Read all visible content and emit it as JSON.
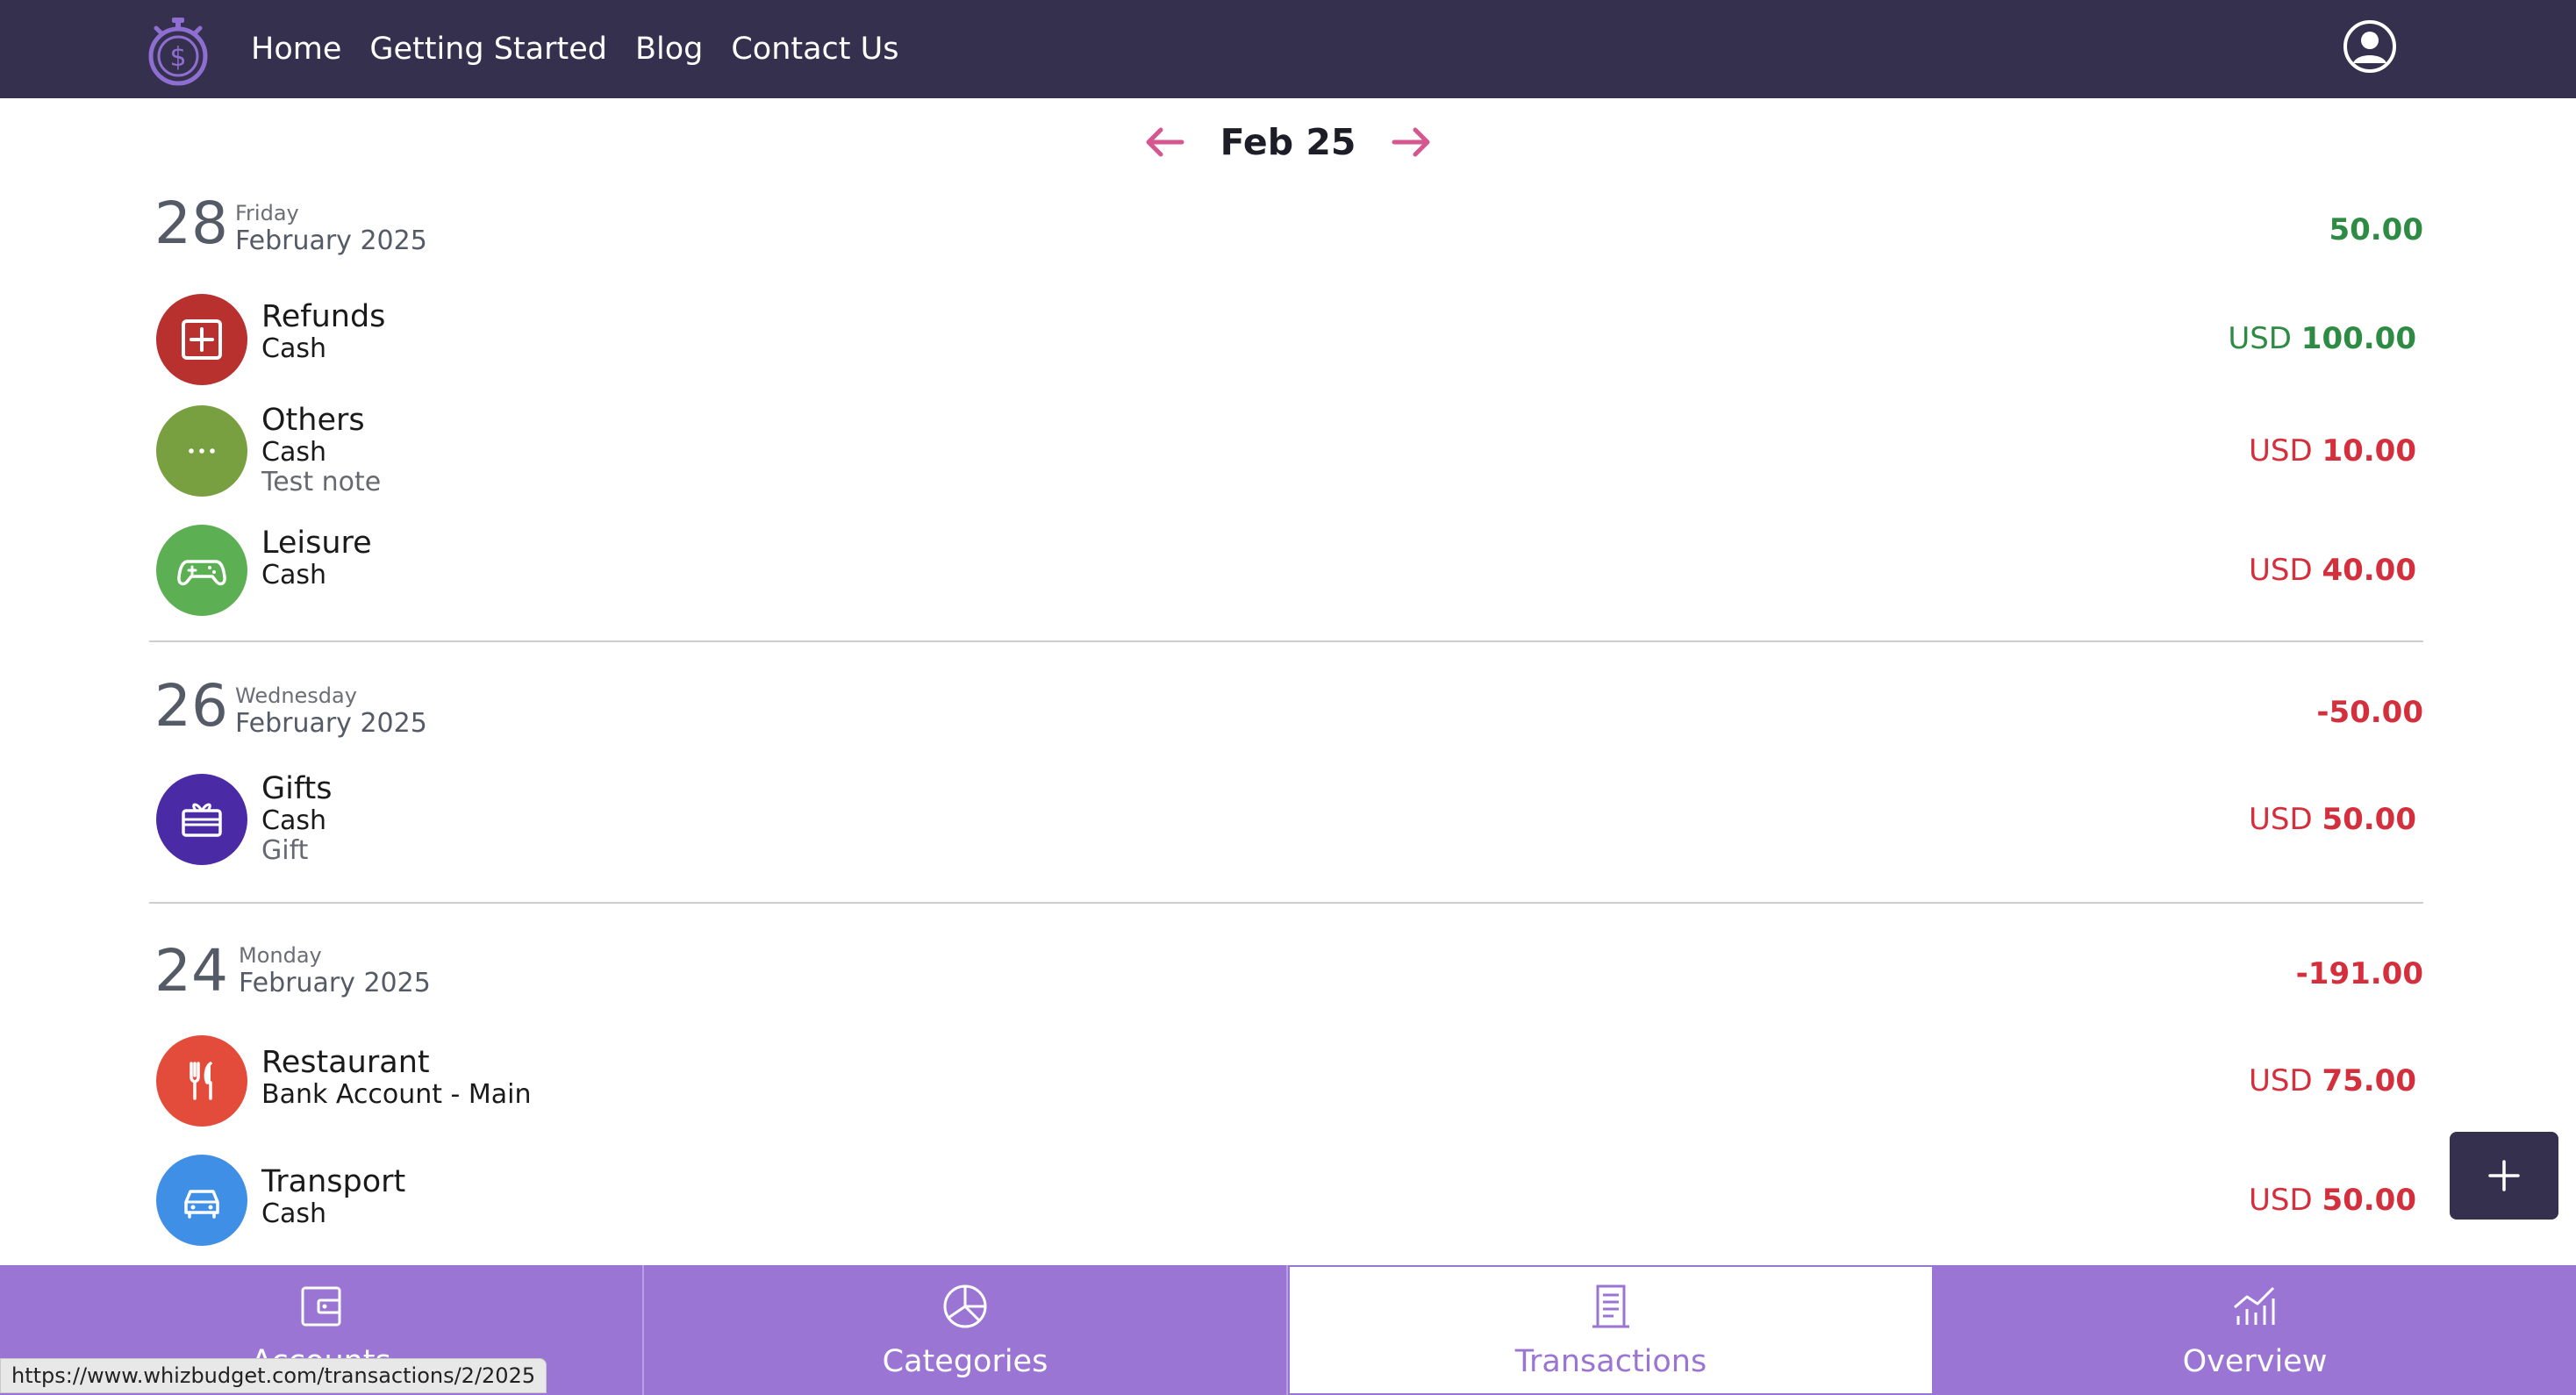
{
  "nav": {
    "links": [
      "Home",
      "Getting Started",
      "Blog",
      "Contact Us"
    ]
  },
  "month_nav": {
    "label": "Feb 25"
  },
  "days": [
    {
      "day": "28",
      "weekday": "Friday",
      "month": "February 2025",
      "total": "50.00",
      "transactions": [
        {
          "category": "Refunds",
          "account": "Cash",
          "note": "",
          "currency": "USD",
          "amount": "100.00",
          "icon": "plus-square-icon"
        },
        {
          "category": "Others",
          "account": "Cash",
          "note": "Test note",
          "currency": "USD",
          "amount": "10.00",
          "icon": "ellipsis-icon"
        },
        {
          "category": "Leisure",
          "account": "Cash",
          "note": "",
          "currency": "USD",
          "amount": "40.00",
          "icon": "gamepad-icon"
        }
      ]
    },
    {
      "day": "26",
      "weekday": "Wednesday",
      "month": "February 2025",
      "total": "-50.00",
      "transactions": [
        {
          "category": "Gifts",
          "account": "Cash",
          "note": "Gift",
          "currency": "USD",
          "amount": "50.00",
          "icon": "gift-card-icon"
        }
      ]
    },
    {
      "day": "24",
      "weekday": "Monday",
      "month": "February 2025",
      "total": "-191.00",
      "transactions": [
        {
          "category": "Restaurant",
          "account": "Bank Account - Main",
          "note": "",
          "currency": "USD",
          "amount": "75.00",
          "icon": "fork-knife-icon"
        },
        {
          "category": "Transport",
          "account": "Cash",
          "note": "",
          "currency": "USD",
          "amount": "50.00",
          "icon": "car-icon"
        }
      ]
    }
  ],
  "bottom_tabs": [
    "Accounts",
    "Categories",
    "Transactions",
    "Overview"
  ],
  "status_url": "https://www.whizbudget.com/transactions/2/2025",
  "colors": {
    "topbar": "#34304d",
    "tabbar": "#9b75d3",
    "positive": "#2e8b44",
    "negative": "#d32f3c",
    "arrow": "#d6568f",
    "refunds": "#b8312f",
    "others": "#79a040",
    "leisure": "#5cb053",
    "gifts": "#4b2aa6",
    "restaurant": "#e34c3a",
    "transport": "#3f8fe6"
  }
}
